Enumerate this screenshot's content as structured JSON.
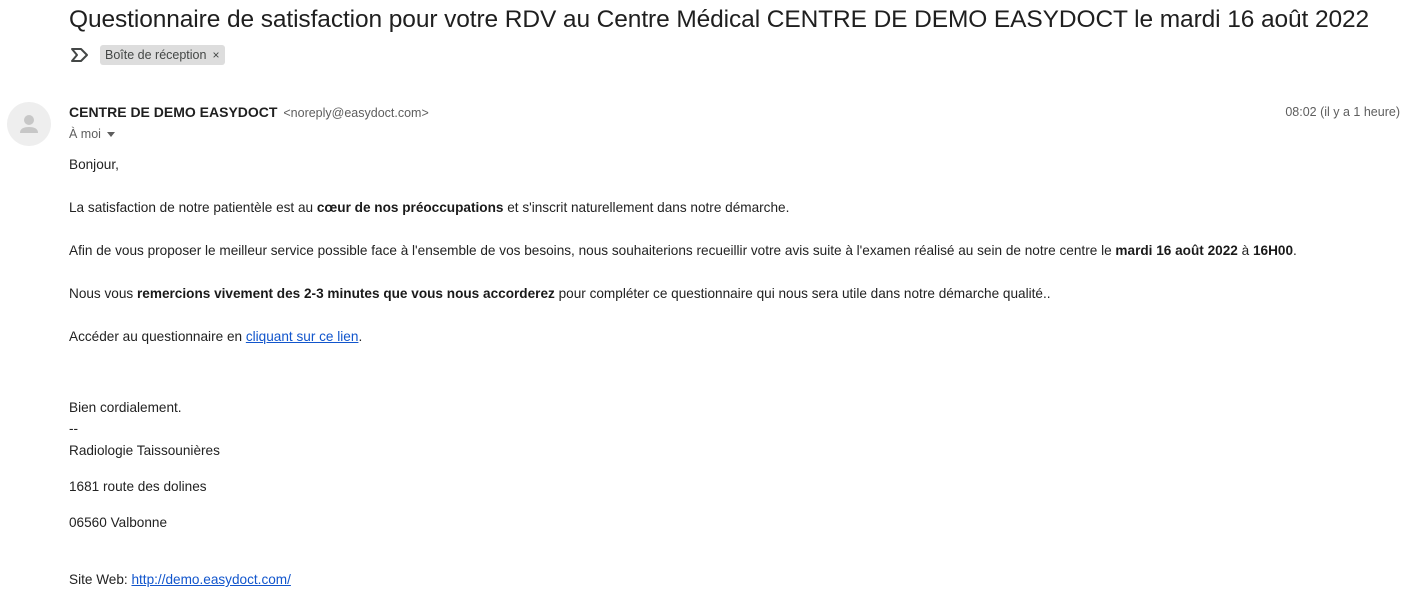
{
  "email": {
    "subject": "Questionnaire de satisfaction pour votre RDV au Centre Médical CENTRE DE DEMO EASYDOCT le mardi 16 août 2022",
    "label_chip": "Boîte de réception",
    "label_close": "×",
    "sender_name": "CENTRE DE DEMO EASYDOCT",
    "sender_email": "<noreply@easydoct.com>",
    "time": "08:02 (il y a 1 heure)",
    "to": "À moi"
  },
  "body": {
    "greeting": "Bonjour,",
    "p1": {
      "a": "La satisfaction de notre patientèle est au ",
      "b": "cœur de nos préoccupations",
      "c": " et s'inscrit naturellement dans notre démarche."
    },
    "p2": {
      "a": "Afin de vous proposer le meilleur service possible face à l'ensemble de vos besoins, nous souhaiterions recueillir votre avis suite à l'examen réalisé au sein de notre centre le ",
      "b": "mardi 16 août 2022",
      "c": " à ",
      "d": "16H00",
      "e": "."
    },
    "p3": {
      "a": "Nous vous ",
      "b": "remercions vivement des 2-3 minutes que vous nous accorderez",
      "c": " pour compléter ce questionnaire qui nous sera utile dans notre démarche qualité.."
    },
    "p4": {
      "a": "Accéder au questionnaire en ",
      "link": "cliquant sur ce lien",
      "c": "."
    },
    "closing": "Bien cordialement.",
    "sig_sep": "--",
    "sig_name": "Radiologie Taissounières",
    "sig_address": "1681 route des dolines",
    "sig_city": "06560 Valbonne",
    "site_label": "Site Web: ",
    "site_link": "http://demo.easydoct.com/"
  }
}
